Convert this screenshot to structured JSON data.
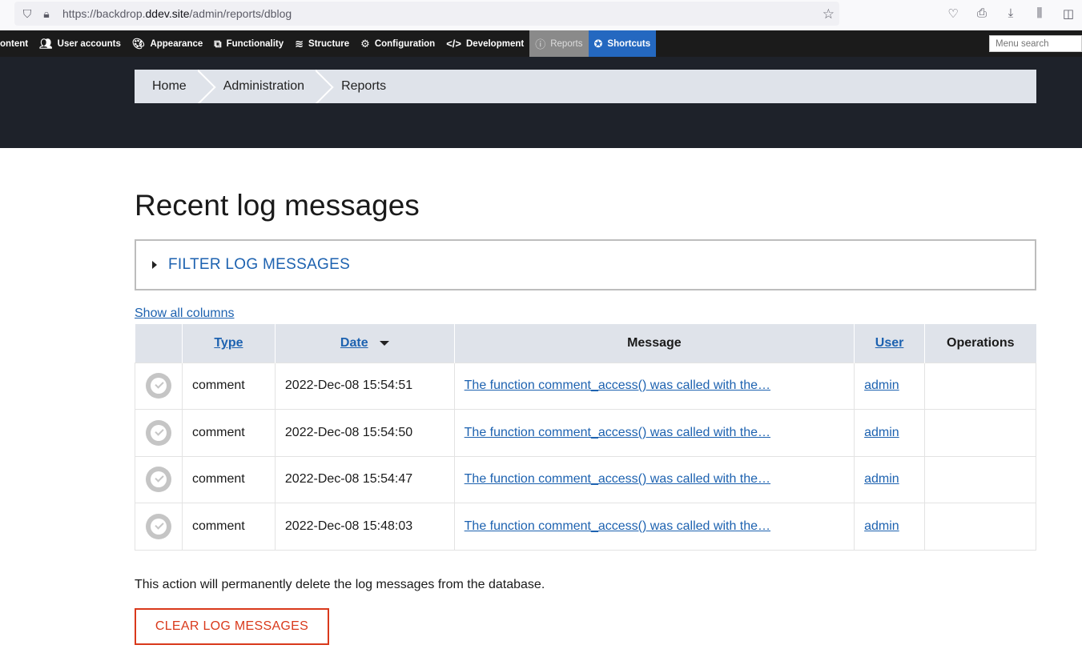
{
  "browser": {
    "url_prefix": "https://backdrop.",
    "url_host": "ddev.site",
    "url_path": "/admin/reports/dblog"
  },
  "admin_menu": {
    "items": [
      {
        "label": "ontent",
        "icon": "content-icon"
      },
      {
        "label": "User accounts",
        "icon": "users-icon"
      },
      {
        "label": "Appearance",
        "icon": "palette-icon"
      },
      {
        "label": "Functionality",
        "icon": "puzzle-icon"
      },
      {
        "label": "Structure",
        "icon": "layers-icon"
      },
      {
        "label": "Configuration",
        "icon": "gear-icon"
      },
      {
        "label": "Development",
        "icon": "code-icon"
      },
      {
        "label": "Reports",
        "icon": "info-icon"
      },
      {
        "label": "Shortcuts",
        "icon": "star-icon"
      }
    ],
    "search_placeholder": "Menu search"
  },
  "breadcrumb": [
    "Home",
    "Administration",
    "Reports"
  ],
  "page_title": "Recent log messages",
  "filter_legend": "FILTER LOG MESSAGES",
  "show_all_columns": "Show all columns",
  "table": {
    "headers": {
      "type": "Type",
      "date": "Date",
      "message": "Message",
      "user": "User",
      "operations": "Operations"
    },
    "rows": [
      {
        "type": "comment",
        "date": "2022-Dec-08 15:54:51",
        "message": "The function comment_access() was called with the…",
        "user": "admin"
      },
      {
        "type": "comment",
        "date": "2022-Dec-08 15:54:50",
        "message": "The function comment_access() was called with the…",
        "user": "admin"
      },
      {
        "type": "comment",
        "date": "2022-Dec-08 15:54:47",
        "message": "The function comment_access() was called with the…",
        "user": "admin"
      },
      {
        "type": "comment",
        "date": "2022-Dec-08 15:48:03",
        "message": "The function comment_access() was called with the…",
        "user": "admin"
      }
    ]
  },
  "notice": "This action will permanently delete the log messages from the database.",
  "clear_button": "CLEAR LOG MESSAGES",
  "colors": {
    "link": "#1d62b0",
    "danger": "#d9391b",
    "header_band": "#1e222a",
    "shortcuts": "#2468c0"
  }
}
